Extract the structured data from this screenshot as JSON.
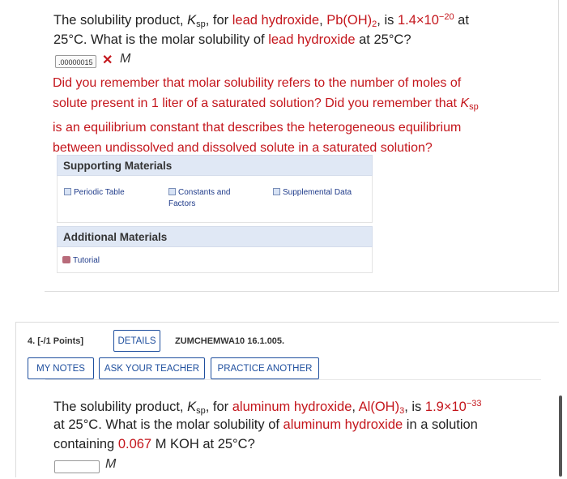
{
  "question1": {
    "line1": {
      "p1": "The solubility product, ",
      "ksp_k": "K",
      "ksp_sub": "sp",
      "p2": ", for ",
      "compound": "lead hydroxide",
      "p3": ", ",
      "formula": "Pb(OH)",
      "formula_sub": "2",
      "p4": ", is ",
      "ksp_value": "1.4×10",
      "ksp_exp": "−20",
      "p5": " at"
    },
    "line2": {
      "p1": "25°C. What is the molar solubility of ",
      "compound": "lead hydroxide",
      "p2": " at 25°C?"
    },
    "answer_value": ".00000015",
    "unit": "M",
    "feedback": {
      "line1": "Did you remember that molar solubility refers to the number of moles of",
      "line2": "solute present in 1 liter of a saturated solution? Did you remember that ",
      "line2_k": "K",
      "line2_sub": "sp",
      "line3": "is an equilibrium constant that describes the heterogeneous equilibrium",
      "line4": "between undissolved and dissolved solute in a saturated solution?"
    }
  },
  "supporting": {
    "title": "Supporting Materials",
    "items": [
      "Periodic Table",
      "Constants and Factors",
      "Supplemental Data"
    ]
  },
  "additional": {
    "title": "Additional Materials",
    "items": [
      "Tutorial"
    ]
  },
  "question2": {
    "number_label": "4.  [-/1 Points]",
    "details_button": "DETAILS",
    "code": "ZUMCHEMWA10 16.1.005.",
    "buttons": [
      "MY NOTES",
      "ASK YOUR TEACHER",
      "PRACTICE ANOTHER"
    ],
    "line1": {
      "p1": "The solubility product, ",
      "ksp_k": "K",
      "ksp_sub": "sp",
      "p2": ", for ",
      "compound": "aluminum hydroxide",
      "p3": ", ",
      "formula": "Al(OH)",
      "formula_sub": "3",
      "p4": ", is ",
      "ksp_value": "1.9×10",
      "ksp_exp": "−33"
    },
    "line2": {
      "p1": "at 25°C. What is the molar solubility of ",
      "compound": "aluminum hydroxide",
      "p2": " in a solution"
    },
    "line3": {
      "p1": "containing ",
      "conc": "0.067",
      "p2": " M KOH at 25°C?"
    },
    "answer_value": "",
    "unit": "M"
  },
  "colors": {
    "accent_red": "#c4161c",
    "button_blue": "#1f4f9e",
    "section_header_bg": "#e0e8f5"
  },
  "icons": {
    "wrong": "x-mark-icon",
    "checkbox": "checkbox-icon",
    "tutorial": "tutorial-icon"
  }
}
